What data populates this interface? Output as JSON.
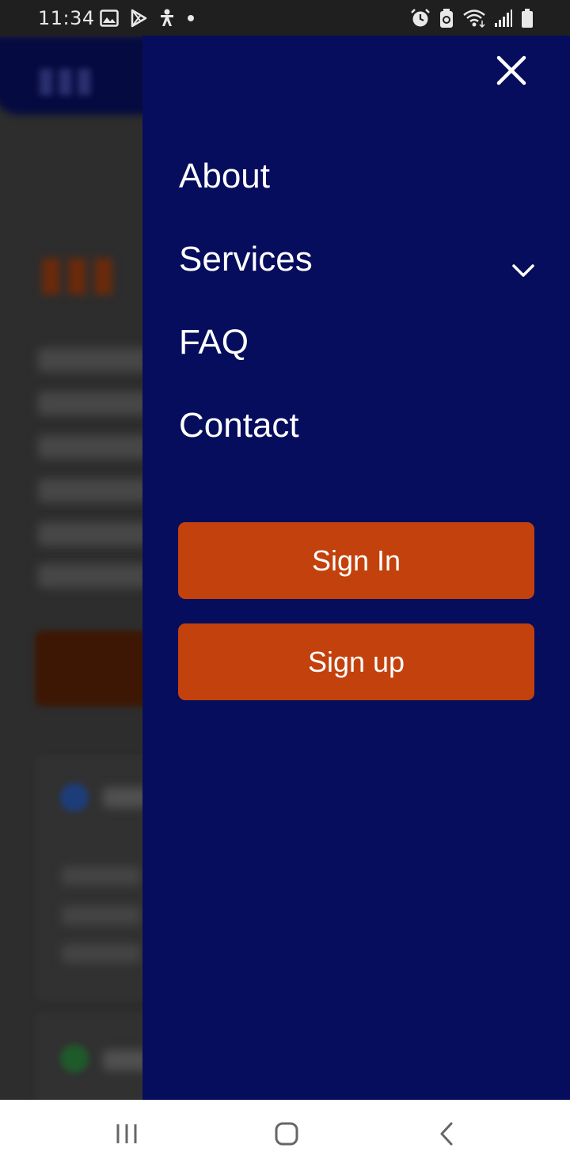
{
  "status_bar": {
    "time": "11:34",
    "left_icons": [
      "image-icon",
      "play-store-icon",
      "accessibility-icon",
      "dot-icon"
    ],
    "right_icons": [
      "alarm-icon",
      "battery-saver-icon",
      "wifi-icon",
      "signal-icon",
      "battery-icon"
    ]
  },
  "drawer": {
    "close_icon": "close-icon",
    "menu_items": [
      {
        "label": "About"
      },
      {
        "label": "Services",
        "has_submenu": true
      },
      {
        "label": "FAQ"
      },
      {
        "label": "Contact"
      }
    ],
    "sign_in_label": "Sign In",
    "sign_up_label": "Sign up",
    "background_color": "#060d5c",
    "button_color": "#c3410d"
  },
  "nav_bar": {
    "buttons": [
      "recent-apps-icon",
      "home-icon",
      "back-icon"
    ]
  }
}
